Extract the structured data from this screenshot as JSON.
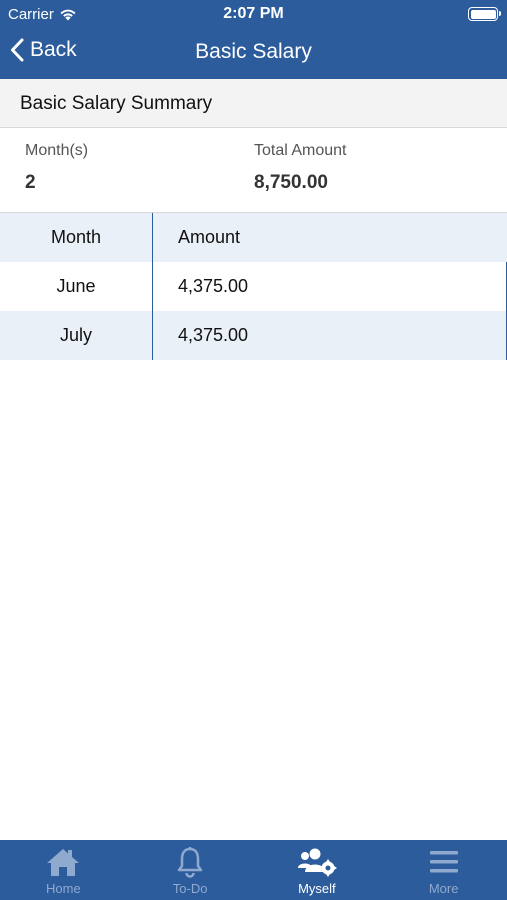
{
  "status_bar": {
    "carrier": "Carrier",
    "time": "2:07 PM"
  },
  "nav": {
    "back_label": "Back",
    "title": "Basic Salary"
  },
  "section": {
    "title": "Basic Salary Summary"
  },
  "summary": {
    "months_label": "Month(s)",
    "months_value": "2",
    "total_label": "Total Amount",
    "total_value": "8,750.00"
  },
  "table": {
    "headers": {
      "month": "Month",
      "amount": "Amount"
    },
    "rows": [
      {
        "month": "June",
        "amount": "4,375.00"
      },
      {
        "month": "July",
        "amount": "4,375.00"
      }
    ]
  },
  "tabbar": {
    "items": [
      {
        "label": "Home",
        "icon": "home-icon"
      },
      {
        "label": "To-Do",
        "icon": "bell-icon"
      },
      {
        "label": "Myself",
        "icon": "user-settings-icon",
        "active": true
      },
      {
        "label": "More",
        "icon": "menu-icon"
      }
    ]
  },
  "colors": {
    "primary": "#2c5c9c",
    "row_alt": "#eaf0f8",
    "tab_inactive": "#8fa9cf"
  }
}
